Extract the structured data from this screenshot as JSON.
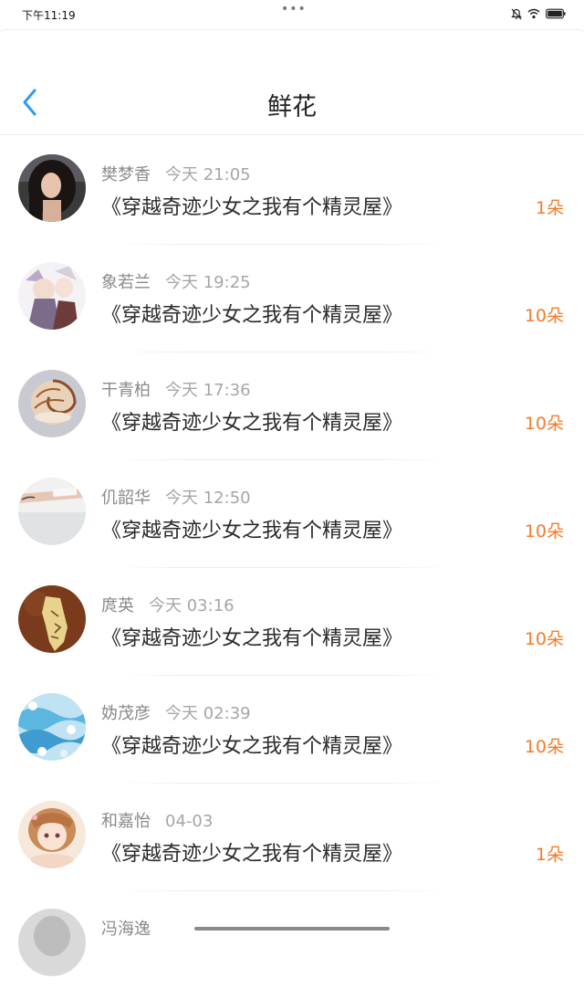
{
  "status_bar": {
    "time": "下午11:19",
    "dots": "•••"
  },
  "nav": {
    "title": "鲜花"
  },
  "colors": {
    "accent_blue": "#2f9bf0",
    "count_orange": "#f57b2a"
  },
  "records": [
    {
      "name": "樊梦香",
      "time": "今天 21:05",
      "book": "《穿越奇迹少女之我有个精灵屋》",
      "count": "1朵"
    },
    {
      "name": "象若兰",
      "time": "今天 19:25",
      "book": "《穿越奇迹少女之我有个精灵屋》",
      "count": "10朵"
    },
    {
      "name": "干青柏",
      "time": "今天 17:36",
      "book": "《穿越奇迹少女之我有个精灵屋》",
      "count": "10朵"
    },
    {
      "name": "仉韶华",
      "time": "今天 12:50",
      "book": "《穿越奇迹少女之我有个精灵屋》",
      "count": "10朵"
    },
    {
      "name": "庹英",
      "time": "今天 03:16",
      "book": "《穿越奇迹少女之我有个精灵屋》",
      "count": "10朵"
    },
    {
      "name": "妫茂彦",
      "time": "今天 02:39",
      "book": "《穿越奇迹少女之我有个精灵屋》",
      "count": "10朵"
    },
    {
      "name": "和嘉怡",
      "time": "04-03",
      "book": "《穿越奇迹少女之我有个精灵屋》",
      "count": "1朵"
    },
    {
      "name": "冯海逸",
      "time": "",
      "book": "",
      "count": ""
    }
  ]
}
